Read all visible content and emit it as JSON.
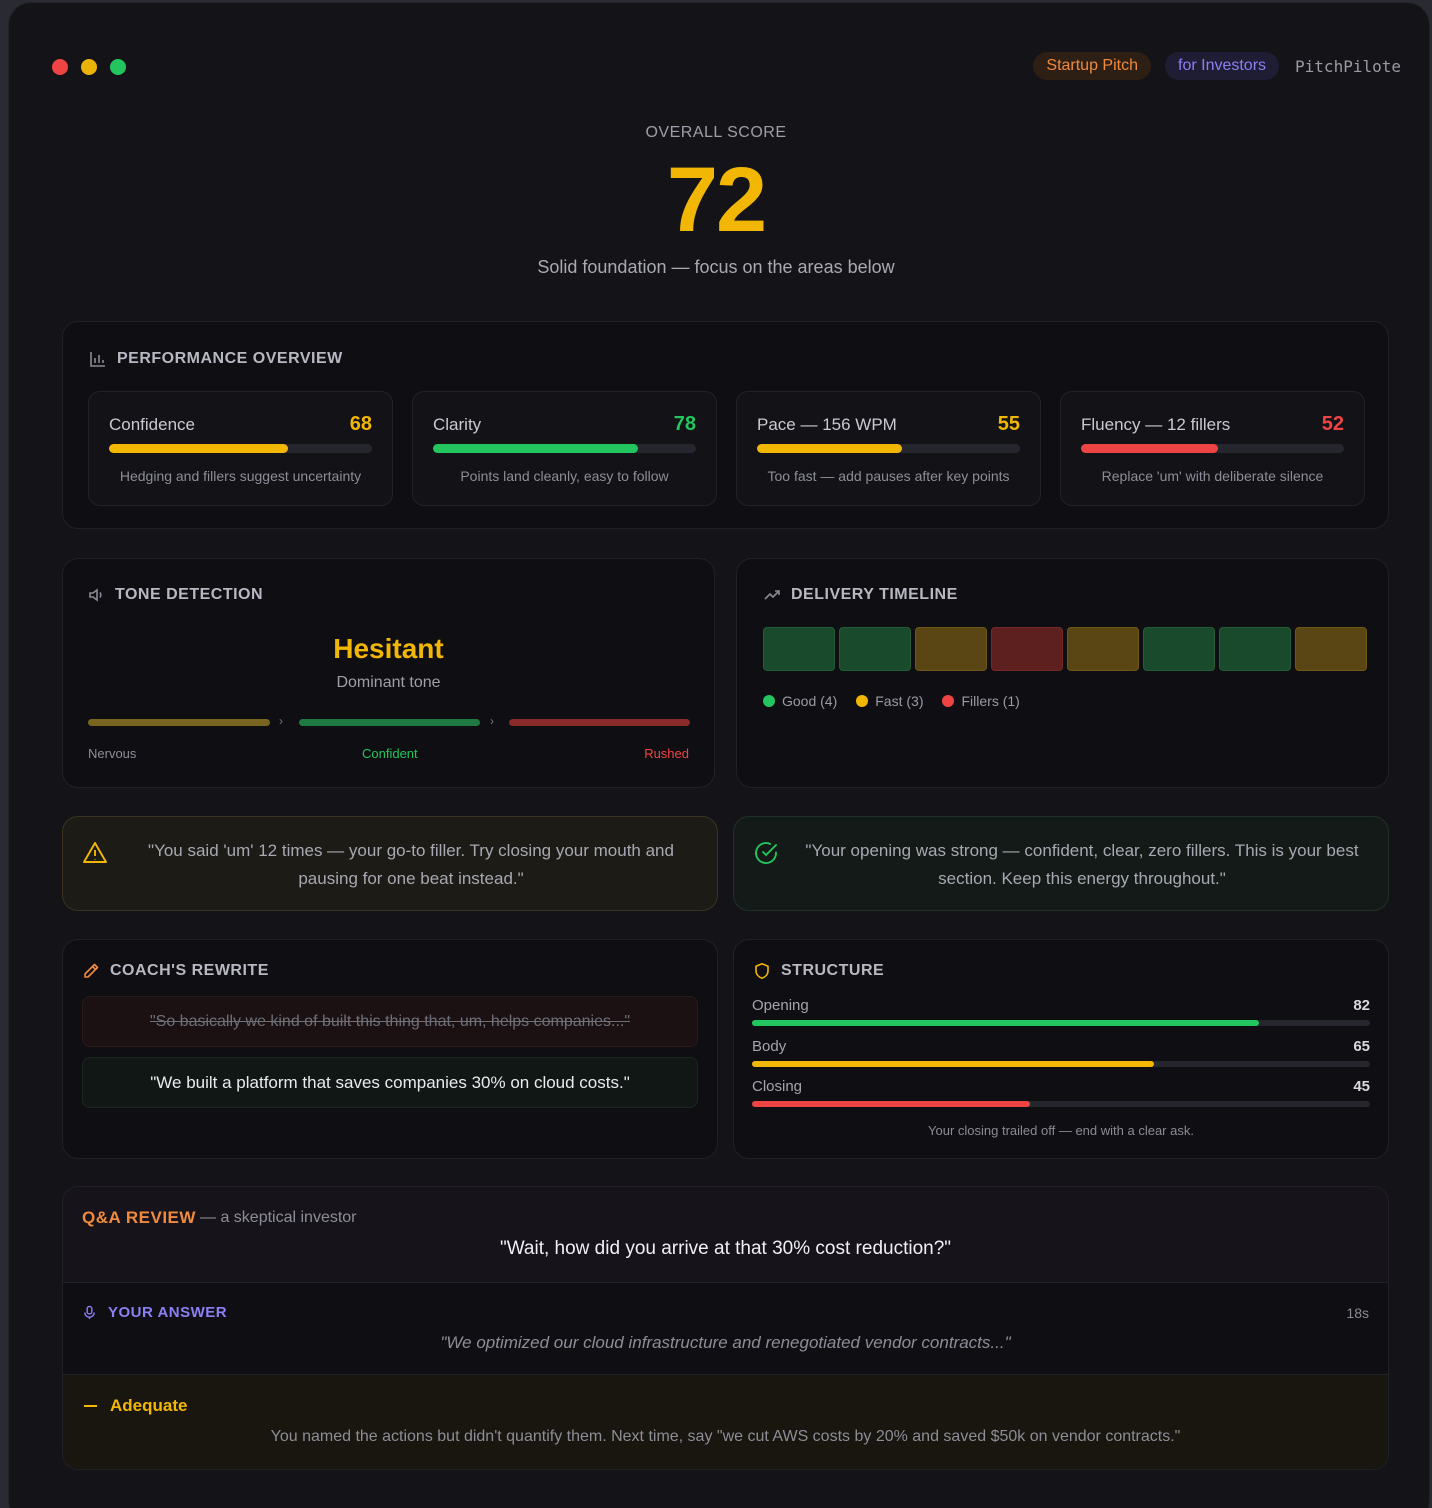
{
  "header": {
    "tag_topic": "Startup Pitch",
    "tag_audience": "for Investors",
    "brand": "PitchPilote"
  },
  "score": {
    "label": "OVERALL SCORE",
    "value": "72",
    "summary": "Solid foundation — focus on the areas below"
  },
  "performance": {
    "title": "PERFORMANCE OVERVIEW",
    "metrics": [
      {
        "label": "Confidence",
        "value": "68",
        "level": 0.68,
        "color": "#f2b705",
        "note": "Hedging and fillers suggest uncertainty"
      },
      {
        "label": "Clarity",
        "value": "78",
        "level": 0.78,
        "color": "#22c55e",
        "note": "Points land cleanly, easy to follow"
      },
      {
        "label": "Pace — 156 WPM",
        "value": "55",
        "level": 0.55,
        "color": "#f2b705",
        "note": "Too fast — add pauses after key points"
      },
      {
        "label": "Fluency — 12 fillers",
        "value": "52",
        "level": 0.52,
        "color": "#ef4444",
        "note": "Replace 'um' with deliberate silence"
      }
    ]
  },
  "tone": {
    "title": "TONE DETECTION",
    "dominant": "Hesitant",
    "dominant_label": "Dominant tone",
    "scale": [
      "Nervous",
      "Confident",
      "Rushed"
    ]
  },
  "timeline": {
    "title": "DELIVERY TIMELINE",
    "segments": [
      "good",
      "good",
      "fast",
      "fillers",
      "fast",
      "good",
      "good",
      "fast"
    ],
    "legend": [
      "Good (4)",
      "Fast (3)",
      "Fillers (1)"
    ],
    "colors": {
      "good": "#22c55e",
      "fast": "#f2b705",
      "fillers": "#ef4444"
    }
  },
  "callouts": {
    "warning": "\"You said 'um' 12 times — your go-to filler. Try closing your mouth and pausing for one beat instead.\"",
    "success": "\"Your opening was strong — confident, clear, zero fillers. This is your best section. Keep this energy throughout.\""
  },
  "rewrite": {
    "title": "COACH'S REWRITE",
    "before": "\"So basically we kind of built this thing that, um, helps companies...\"",
    "after": "\"We built a platform that saves companies 30% on cloud costs.\""
  },
  "structure": {
    "title": "STRUCTURE",
    "rows": [
      {
        "label": "Opening",
        "value": "82",
        "level": 0.82,
        "color": "#22c55e"
      },
      {
        "label": "Body",
        "value": "65",
        "level": 0.65,
        "color": "#f2b705"
      },
      {
        "label": "Closing",
        "value": "45",
        "level": 0.45,
        "color": "#ef4444"
      }
    ],
    "note": "Your closing trailed off — end with a clear ask."
  },
  "qa": {
    "title": "Q&A REVIEW",
    "persona": "— a skeptical investor",
    "question": "\"Wait, how did you arrive at that 30% cost reduction?\"",
    "answer_label": "YOUR ANSWER",
    "duration": "18s",
    "answer": "\"We optimized our cloud infrastructure and renegotiated vendor contracts...\"",
    "verdict": "Adequate",
    "feedback": "You named the actions but didn't quantify them. Next time, say \"we cut AWS costs by 20% and saved $50k on vendor contracts.\""
  }
}
